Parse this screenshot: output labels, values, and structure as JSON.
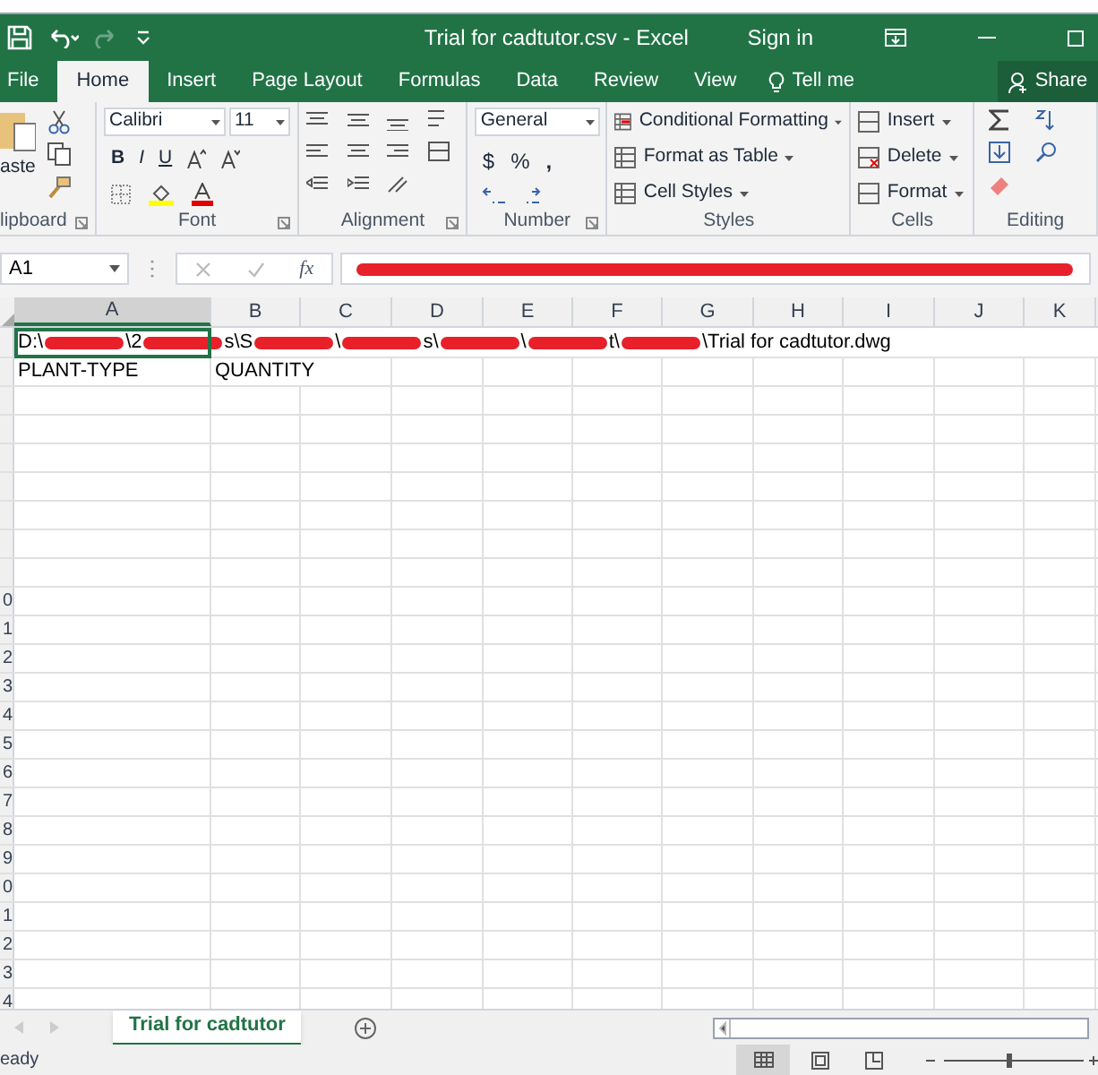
{
  "title_bar": {
    "title": "Trial for cadtutor.csv  -  Excel",
    "sign_in": "Sign in"
  },
  "ribbon_tabs": [
    {
      "label": "File",
      "selected": false
    },
    {
      "label": "Home",
      "selected": true
    },
    {
      "label": "Insert",
      "selected": false
    },
    {
      "label": "Page Layout",
      "selected": false
    },
    {
      "label": "Formulas",
      "selected": false
    },
    {
      "label": "Data",
      "selected": false
    },
    {
      "label": "Review",
      "selected": false
    },
    {
      "label": "View",
      "selected": false
    }
  ],
  "tell_me": "Tell me",
  "share": "Share",
  "ribbon": {
    "paste": "aste",
    "font_name": "Calibri",
    "font_size": "11",
    "bold": "B",
    "italic": "I",
    "underline": "U",
    "number_format": "General",
    "currency": "$",
    "percent": "%",
    "comma": ",",
    "styles": [
      "Conditional Formatting",
      "Format as Table",
      "Cell Styles"
    ],
    "cells": [
      "Insert",
      "Delete",
      "Format"
    ],
    "groups": [
      "lipboard",
      "Font",
      "Alignment",
      "Number",
      "Styles",
      "Cells",
      "Editing"
    ]
  },
  "formula_bar": {
    "name_box": "A1",
    "fx": "fx"
  },
  "columns": [
    "A",
    "B",
    "C",
    "D",
    "E",
    "F",
    "G",
    "H",
    "I",
    "J",
    "K"
  ],
  "a1_segments": [
    {
      "kind": "text",
      "text": "D:\\"
    },
    {
      "kind": "redacted"
    },
    {
      "kind": "text",
      "text": "\\2"
    },
    {
      "kind": "redacted"
    },
    {
      "kind": "text",
      "text": "s\\S"
    },
    {
      "kind": "redacted"
    },
    {
      "kind": "text",
      "text": "\\"
    },
    {
      "kind": "redacted"
    },
    {
      "kind": "text",
      "text": "s\\"
    },
    {
      "kind": "redacted"
    },
    {
      "kind": "text",
      "text": "\\"
    },
    {
      "kind": "redacted"
    },
    {
      "kind": "text",
      "text": "t\\"
    },
    {
      "kind": "redacted"
    },
    {
      "kind": "text",
      "text": "\\Trial for cadtutor.dwg"
    }
  ],
  "rows": [
    {
      "header": "",
      "cells": []
    },
    {
      "header": "",
      "cells": [
        "PLANT-TYPE",
        "QUANTITY"
      ]
    },
    {
      "header": "",
      "cells": []
    },
    {
      "header": "",
      "cells": []
    },
    {
      "header": "",
      "cells": []
    },
    {
      "header": "",
      "cells": []
    },
    {
      "header": "",
      "cells": []
    },
    {
      "header": "",
      "cells": []
    },
    {
      "header": "",
      "cells": []
    },
    {
      "header": "0",
      "cells": []
    },
    {
      "header": "1",
      "cells": []
    },
    {
      "header": "2",
      "cells": []
    },
    {
      "header": "3",
      "cells": []
    },
    {
      "header": "4",
      "cells": []
    },
    {
      "header": "5",
      "cells": []
    },
    {
      "header": "6",
      "cells": []
    },
    {
      "header": "7",
      "cells": []
    },
    {
      "header": "8",
      "cells": []
    },
    {
      "header": "9",
      "cells": []
    },
    {
      "header": "0",
      "cells": []
    },
    {
      "header": "1",
      "cells": []
    },
    {
      "header": "2",
      "cells": []
    },
    {
      "header": "3",
      "cells": []
    },
    {
      "header": "4",
      "cells": []
    }
  ],
  "sheet_tabs": [
    {
      "label": "Trial for cadtutor",
      "selected": true
    }
  ],
  "status_bar": {
    "text": "eady"
  }
}
